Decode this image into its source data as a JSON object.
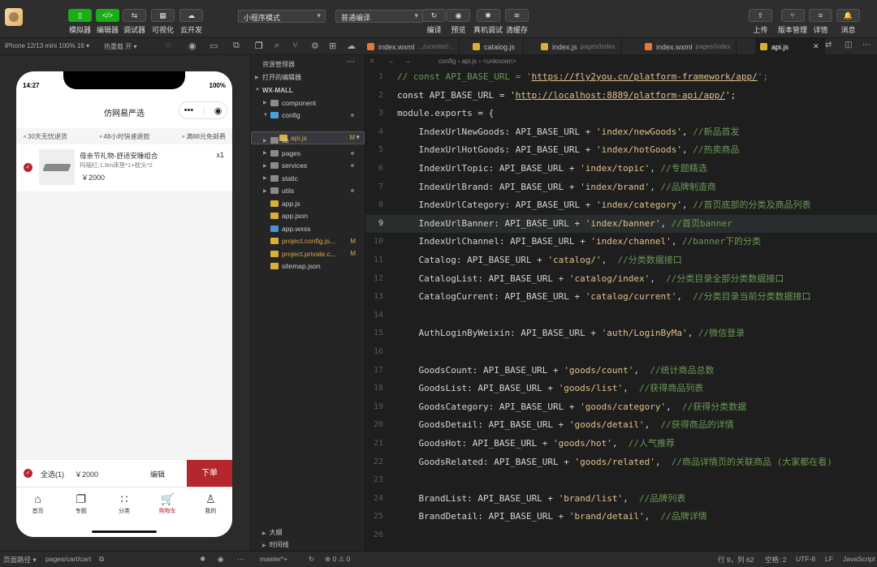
{
  "toolbar": {
    "left_buttons": [
      {
        "label": "模拟器",
        "icon": "▯"
      },
      {
        "label": "编辑器",
        "icon": "</>"
      },
      {
        "label": "调试器",
        "icon": "⇆"
      },
      {
        "label": "可视化",
        "icon": "▦"
      },
      {
        "label": "云开发",
        "icon": "☁"
      }
    ],
    "mode_select": "小程序模式",
    "compile_select": "普通编译",
    "mid_buttons": [
      {
        "label": "编译",
        "icon": "↻"
      },
      {
        "label": "预览",
        "icon": "◉"
      },
      {
        "label": "真机调试",
        "icon": "✱"
      },
      {
        "label": "清缓存",
        "icon": "≋"
      }
    ],
    "right_buttons": [
      {
        "label": "上传",
        "icon": "⇪"
      },
      {
        "label": "版本管理",
        "icon": "⑂"
      },
      {
        "label": "详情",
        "icon": "≡"
      },
      {
        "label": "消息",
        "icon": "🔔"
      }
    ]
  },
  "device_bar": {
    "device": "iPhone 12/13 mini 100% 16 ▾",
    "hot_reload": "热重载 开 ▾"
  },
  "tabs": [
    {
      "name": "index.wxml",
      "sub": ".../ucenter/..."
    },
    {
      "name": "catalog.js",
      "sub": ""
    },
    {
      "name": "index.js",
      "sub": "pages/index"
    },
    {
      "name": "index.wxml",
      "sub": "pages/index"
    },
    {
      "name": "api.js",
      "sub": "",
      "close": "✕"
    }
  ],
  "phone": {
    "time": "14:27",
    "battery": "100%",
    "title": "仿网易严选",
    "promos": [
      "30天无忧退货",
      "48小时快速退款",
      "满88元免邮费"
    ],
    "item": {
      "name": "母亲节礼物-舒适安睡组合",
      "spec": "玛瑙红;1.8m床垫*1+枕头*2",
      "price": "￥2000",
      "qty": "x1"
    },
    "select_all": "全选(1)",
    "total": "￥2000",
    "edit": "编辑",
    "order": "下单",
    "tabbar": [
      {
        "label": "首页",
        "icon": "⌂"
      },
      {
        "label": "专题",
        "icon": "❐"
      },
      {
        "label": "分类",
        "icon": "∷"
      },
      {
        "label": "购物车",
        "icon": "🛒"
      },
      {
        "label": "我的",
        "icon": "♙"
      }
    ]
  },
  "explorer": {
    "title": "资源管理器",
    "open_editors": "打开的编辑器",
    "project": "WX-MALL",
    "rows": [
      {
        "name": "component",
        "type": "folder",
        "depth": 1
      },
      {
        "name": "config",
        "type": "folder-open",
        "depth": 1,
        "dot": true
      },
      {
        "name": "api.js",
        "type": "js",
        "depth": 2,
        "status": "M"
      },
      {
        "name": "lib",
        "type": "folder",
        "depth": 1
      },
      {
        "name": "pages",
        "type": "folder",
        "depth": 1,
        "dot": true
      },
      {
        "name": "services",
        "type": "folder",
        "depth": 1,
        "dot": true
      },
      {
        "name": "static",
        "type": "folder",
        "depth": 1
      },
      {
        "name": "utils",
        "type": "folder",
        "depth": 1,
        "dot": true
      },
      {
        "name": "app.js",
        "type": "js",
        "depth": 1
      },
      {
        "name": "app.json",
        "type": "json",
        "depth": 1
      },
      {
        "name": "app.wxss",
        "type": "css",
        "depth": 1
      },
      {
        "name": "project.config.js...",
        "type": "json",
        "depth": 1,
        "status": "M"
      },
      {
        "name": "project.private.c...",
        "type": "json",
        "depth": 1,
        "status": "M"
      },
      {
        "name": "sitemap.json",
        "type": "json",
        "depth": 1
      }
    ],
    "outline": "大纲",
    "timeline": "时间线"
  },
  "editor": {
    "breadcrumb": "config  ›  api.js  ›  <unknown>",
    "current_line": 9,
    "lines": [
      [
        [
          "c-cm",
          "// const API_BASE_URL = '"
        ],
        [
          "c-url",
          "https://fly2you.cn/platform-framework/app/"
        ],
        [
          "c-cm",
          "';"
        ]
      ],
      [
        [
          "c-kw",
          "const "
        ],
        [
          "c-id",
          "API_BASE_URL = '"
        ],
        [
          "c-url",
          "http://localhost:8889/platform-api/app/"
        ],
        [
          "c-id",
          "';"
        ]
      ],
      [
        [
          "c-id",
          "module.exports = {"
        ]
      ],
      [
        [
          "c-id",
          "    IndexUrlNewGoods: API_BASE_URL + "
        ],
        [
          "c-str",
          "'index/newGoods'"
        ],
        [
          "c-id",
          ", "
        ],
        [
          "c-gr",
          "//新品首发"
        ]
      ],
      [
        [
          "c-id",
          "    IndexUrlHotGoods: API_BASE_URL + "
        ],
        [
          "c-str",
          "'index/hotGoods'"
        ],
        [
          "c-id",
          ", "
        ],
        [
          "c-gr",
          "//热卖商品"
        ]
      ],
      [
        [
          "c-id",
          "    IndexUrlTopic: API_BASE_URL + "
        ],
        [
          "c-str",
          "'index/topic'"
        ],
        [
          "c-id",
          ", "
        ],
        [
          "c-gr",
          "//专题精选"
        ]
      ],
      [
        [
          "c-id",
          "    IndexUrlBrand: API_BASE_URL + "
        ],
        [
          "c-str",
          "'index/brand'"
        ],
        [
          "c-id",
          ", "
        ],
        [
          "c-gr",
          "//品牌制造商"
        ]
      ],
      [
        [
          "c-id",
          "    IndexUrlCategory: API_BASE_URL + "
        ],
        [
          "c-str",
          "'index/category'"
        ],
        [
          "c-id",
          ", "
        ],
        [
          "c-gr",
          "//首页底部的分类及商品列表"
        ]
      ],
      [
        [
          "c-id",
          "    IndexUrlBanner: API_BASE_URL + "
        ],
        [
          "c-str",
          "'index/banner'"
        ],
        [
          "c-id",
          ", "
        ],
        [
          "c-gr",
          "//首页banner"
        ]
      ],
      [
        [
          "c-id",
          "    IndexUrlChannel: API_BASE_URL + "
        ],
        [
          "c-str",
          "'index/channel'"
        ],
        [
          "c-id",
          ", "
        ],
        [
          "c-gr",
          "//banner下的分类"
        ]
      ],
      [
        [
          "c-id",
          "    Catalog: API_BASE_URL + "
        ],
        [
          "c-str",
          "'catalog/'"
        ],
        [
          "c-id",
          ",  "
        ],
        [
          "c-gr",
          "//分类数据接口"
        ]
      ],
      [
        [
          "c-id",
          "    CatalogList: API_BASE_URL + "
        ],
        [
          "c-str",
          "'catalog/index'"
        ],
        [
          "c-id",
          ",  "
        ],
        [
          "c-gr",
          "//分类目录全部分类数据接口"
        ]
      ],
      [
        [
          "c-id",
          "    CatalogCurrent: API_BASE_URL + "
        ],
        [
          "c-str",
          "'catalog/current'"
        ],
        [
          "c-id",
          ",  "
        ],
        [
          "c-gr",
          "//分类目录当前分类数据接口"
        ]
      ],
      [],
      [
        [
          "c-id",
          "    AuthLoginByWeixin: API_BASE_URL + "
        ],
        [
          "c-str",
          "'auth/LoginByMa'"
        ],
        [
          "c-id",
          ", "
        ],
        [
          "c-gr",
          "//微信登录"
        ]
      ],
      [],
      [
        [
          "c-id",
          "    GoodsCount: API_BASE_URL + "
        ],
        [
          "c-str",
          "'goods/count'"
        ],
        [
          "c-id",
          ",  "
        ],
        [
          "c-gr",
          "//统计商品总数"
        ]
      ],
      [
        [
          "c-id",
          "    GoodsList: API_BASE_URL + "
        ],
        [
          "c-str",
          "'goods/list'"
        ],
        [
          "c-id",
          ",  "
        ],
        [
          "c-gr",
          "//获得商品列表"
        ]
      ],
      [
        [
          "c-id",
          "    GoodsCategory: API_BASE_URL + "
        ],
        [
          "c-str",
          "'goods/category'"
        ],
        [
          "c-id",
          ",  "
        ],
        [
          "c-gr",
          "//获得分类数据"
        ]
      ],
      [
        [
          "c-id",
          "    GoodsDetail: API_BASE_URL + "
        ],
        [
          "c-str",
          "'goods/detail'"
        ],
        [
          "c-id",
          ",  "
        ],
        [
          "c-gr",
          "//获得商品的详情"
        ]
      ],
      [
        [
          "c-id",
          "    GoodsHot: API_BASE_URL + "
        ],
        [
          "c-str",
          "'goods/hot'"
        ],
        [
          "c-id",
          ",  "
        ],
        [
          "c-gr",
          "//人气推荐"
        ]
      ],
      [
        [
          "c-id",
          "    GoodsRelated: API_BASE_URL + "
        ],
        [
          "c-str",
          "'goods/related'"
        ],
        [
          "c-id",
          ",  "
        ],
        [
          "c-gr",
          "//商品详情页的关联商品 (大家都在看)"
        ]
      ],
      [],
      [
        [
          "c-id",
          "    BrandList: API_BASE_URL + "
        ],
        [
          "c-str",
          "'brand/list'"
        ],
        [
          "c-id",
          ",  "
        ],
        [
          "c-gr",
          "//品牌列表"
        ]
      ],
      [
        [
          "c-id",
          "    BrandDetail: API_BASE_URL + "
        ],
        [
          "c-str",
          "'brand/detail'"
        ],
        [
          "c-id",
          ",  "
        ],
        [
          "c-gr",
          "//品牌详情"
        ]
      ],
      []
    ]
  },
  "status": {
    "page_path_label": "页面路径 ▾",
    "page_path": "pages/cart/cart",
    "branch": "master*+",
    "problems": "⊗ 0 ⚠ 0",
    "cursor": "行 9，列 62",
    "indent": "空格: 2",
    "encoding": "UTF-8",
    "eol": "LF",
    "language": "JavaScript"
  },
  "colors": {
    "brand_red": "#b4282d",
    "wechat_green": "#1aad19"
  }
}
